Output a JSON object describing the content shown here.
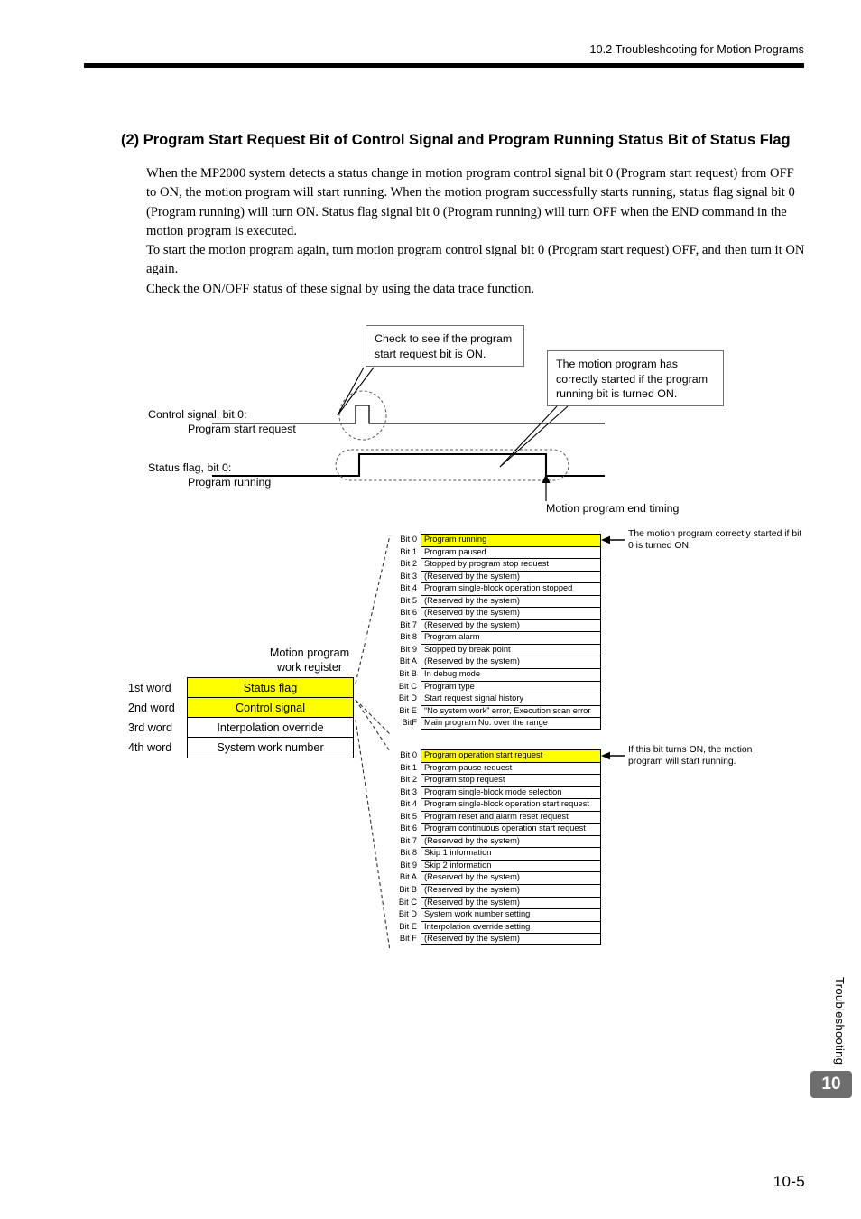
{
  "header": {
    "running_head": "10.2  Troubleshooting for Motion Programs"
  },
  "section": {
    "title": "(2) Program Start Request Bit of Control Signal and Program Running Status Bit of Status Flag"
  },
  "body": {
    "paragraph_1": "When the MP2000 system detects a status change in motion program control signal bit 0 (Program start request) from OFF to ON, the motion program will start running. When the motion program successfully starts running, status flag signal bit 0 (Program running) will turn ON. Status flag signal bit 0 (Program running) will turn OFF when the END command in the motion program is executed.",
    "paragraph_2": "To start the motion program again, turn motion program control signal bit 0 (Program start request) OFF, and then turn it ON again.",
    "paragraph_3": "Check the ON/OFF status of these signal by using the data trace function."
  },
  "timing_diagram": {
    "control_label_line1": "Control signal, bit 0:",
    "control_label_line2": "Program start request",
    "status_label_line1": "Status flag, bit 0:",
    "status_label_line2": "Program running",
    "callout_check": "Check to see if the program start request bit is ON.",
    "callout_started": "The motion program has correctly started if the program running bit is turned ON.",
    "end_timing_label": "Motion program end timing"
  },
  "work_register": {
    "title_line1": "Motion program",
    "title_line2": "work register",
    "rows": [
      {
        "index": "1st word",
        "label": "Status flag",
        "highlight": true
      },
      {
        "index": "2nd word",
        "label": "Control signal",
        "highlight": true
      },
      {
        "index": "3rd word",
        "label": "Interpolation override",
        "highlight": false
      },
      {
        "index": "4th word",
        "label": "System work number",
        "highlight": false
      }
    ]
  },
  "status_flag_table": {
    "note": "The motion program correctly started if bit 0 is turned ON.",
    "rows": [
      {
        "bit": "Bit 0",
        "text": "Program running",
        "highlight": true
      },
      {
        "bit": "Bit 1",
        "text": "Program paused",
        "highlight": false
      },
      {
        "bit": "Bit 2",
        "text": "Stopped by program stop request",
        "highlight": false
      },
      {
        "bit": "Bit 3",
        "text": "(Reserved by the system)",
        "highlight": false
      },
      {
        "bit": "Bit 4",
        "text": "Program single-block operation stopped",
        "highlight": false
      },
      {
        "bit": "Bit 5",
        "text": "(Reserved by the system)",
        "highlight": false
      },
      {
        "bit": "Bit 6",
        "text": "(Reserved by the system)",
        "highlight": false
      },
      {
        "bit": "Bit 7",
        "text": "(Reserved by the system)",
        "highlight": false
      },
      {
        "bit": "Bit 8",
        "text": "Program alarm",
        "highlight": false
      },
      {
        "bit": "Bit 9",
        "text": "Stopped by break point",
        "highlight": false
      },
      {
        "bit": "Bit A",
        "text": "(Reserved by the system)",
        "highlight": false
      },
      {
        "bit": "Bit B",
        "text": "In debug mode",
        "highlight": false
      },
      {
        "bit": "Bit C",
        "text": "Program type",
        "highlight": false
      },
      {
        "bit": "Bit D",
        "text": "Start request signal history",
        "highlight": false
      },
      {
        "bit": "Bit E",
        "text": "“No system work” error, Execution scan error",
        "highlight": false
      },
      {
        "bit": "BitF",
        "text": "Main program No. over the range",
        "highlight": false
      }
    ]
  },
  "control_signal_table": {
    "note": "If this bit turns ON, the motion program will start running.",
    "rows": [
      {
        "bit": "Bit 0",
        "text": "Program operation start request",
        "highlight": true
      },
      {
        "bit": "Bit 1",
        "text": "Program pause request",
        "highlight": false
      },
      {
        "bit": "Bit 2",
        "text": "Program stop request",
        "highlight": false
      },
      {
        "bit": "Bit 3",
        "text": "Program single-block mode selection",
        "highlight": false
      },
      {
        "bit": "Bit 4",
        "text": "Program single-block operation start request",
        "highlight": false
      },
      {
        "bit": "Bit 5",
        "text": "Program reset and alarm reset request",
        "highlight": false
      },
      {
        "bit": "Bit 6",
        "text": "Program continuous operation start request",
        "highlight": false
      },
      {
        "bit": "Bit 7",
        "text": "(Reserved by the system)",
        "highlight": false
      },
      {
        "bit": "Bit 8",
        "text": "Skip 1 information",
        "highlight": false
      },
      {
        "bit": "Bit 9",
        "text": "Skip 2 information",
        "highlight": false
      },
      {
        "bit": "Bit A",
        "text": "(Reserved by the system)",
        "highlight": false
      },
      {
        "bit": "Bit B",
        "text": "(Reserved by the system)",
        "highlight": false
      },
      {
        "bit": "Bit C",
        "text": "(Reserved by the system)",
        "highlight": false
      },
      {
        "bit": "Bit D",
        "text": "System work number setting",
        "highlight": false
      },
      {
        "bit": "Bit E",
        "text": "Interpolation override setting",
        "highlight": false
      },
      {
        "bit": "Bit F",
        "text": "(Reserved by the system)",
        "highlight": false
      }
    ]
  },
  "footer": {
    "side_tab_word": "Troubleshooting",
    "chapter_number": "10",
    "page_number": "10-5"
  },
  "colors": {
    "highlight": "#FFFF00",
    "chapter_tab_bg": "#6E6E6E",
    "rule": "#000000"
  }
}
